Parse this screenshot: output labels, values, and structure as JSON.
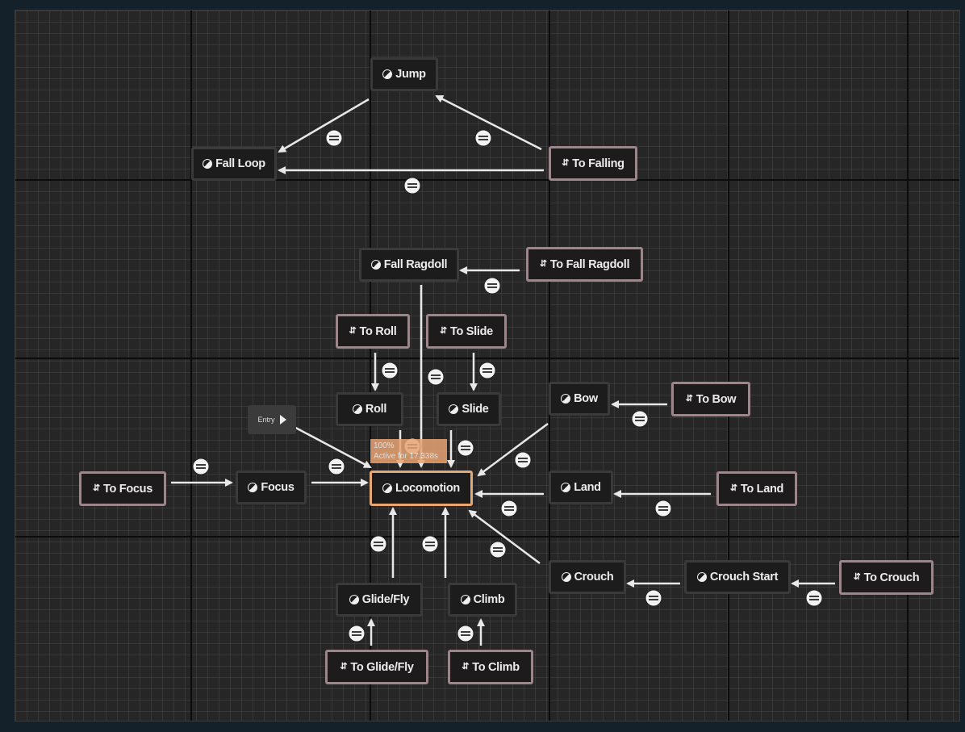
{
  "graph": {
    "entry_label": "Entry",
    "activity": {
      "percent": "100%",
      "active_text": "Active for 17.338s"
    },
    "nodes": {
      "jump": "Jump",
      "fall_loop": "Fall Loop",
      "to_falling": "To Falling",
      "fall_ragdoll": "Fall Ragdoll",
      "to_fall_ragdoll": "To Fall Ragdoll",
      "to_roll": "To Roll",
      "to_slide": "To Slide",
      "roll": "Roll",
      "slide": "Slide",
      "bow": "Bow",
      "to_bow": "To Bow",
      "to_focus": "To Focus",
      "focus": "Focus",
      "locomotion": "Locomotion",
      "land": "Land",
      "to_land": "To Land",
      "crouch": "Crouch",
      "crouch_start": "Crouch Start",
      "to_crouch": "To Crouch",
      "glide_fly": "Glide/Fly",
      "climb": "Climb",
      "to_glide_fly": "To Glide/Fly",
      "to_climb": "To Climb"
    },
    "colors": {
      "background": "#262626",
      "node_border": "#3a3a3a",
      "conduit_border": "#9c858b",
      "active_border": "#e6a873",
      "edge": "#e8e8e8"
    }
  }
}
